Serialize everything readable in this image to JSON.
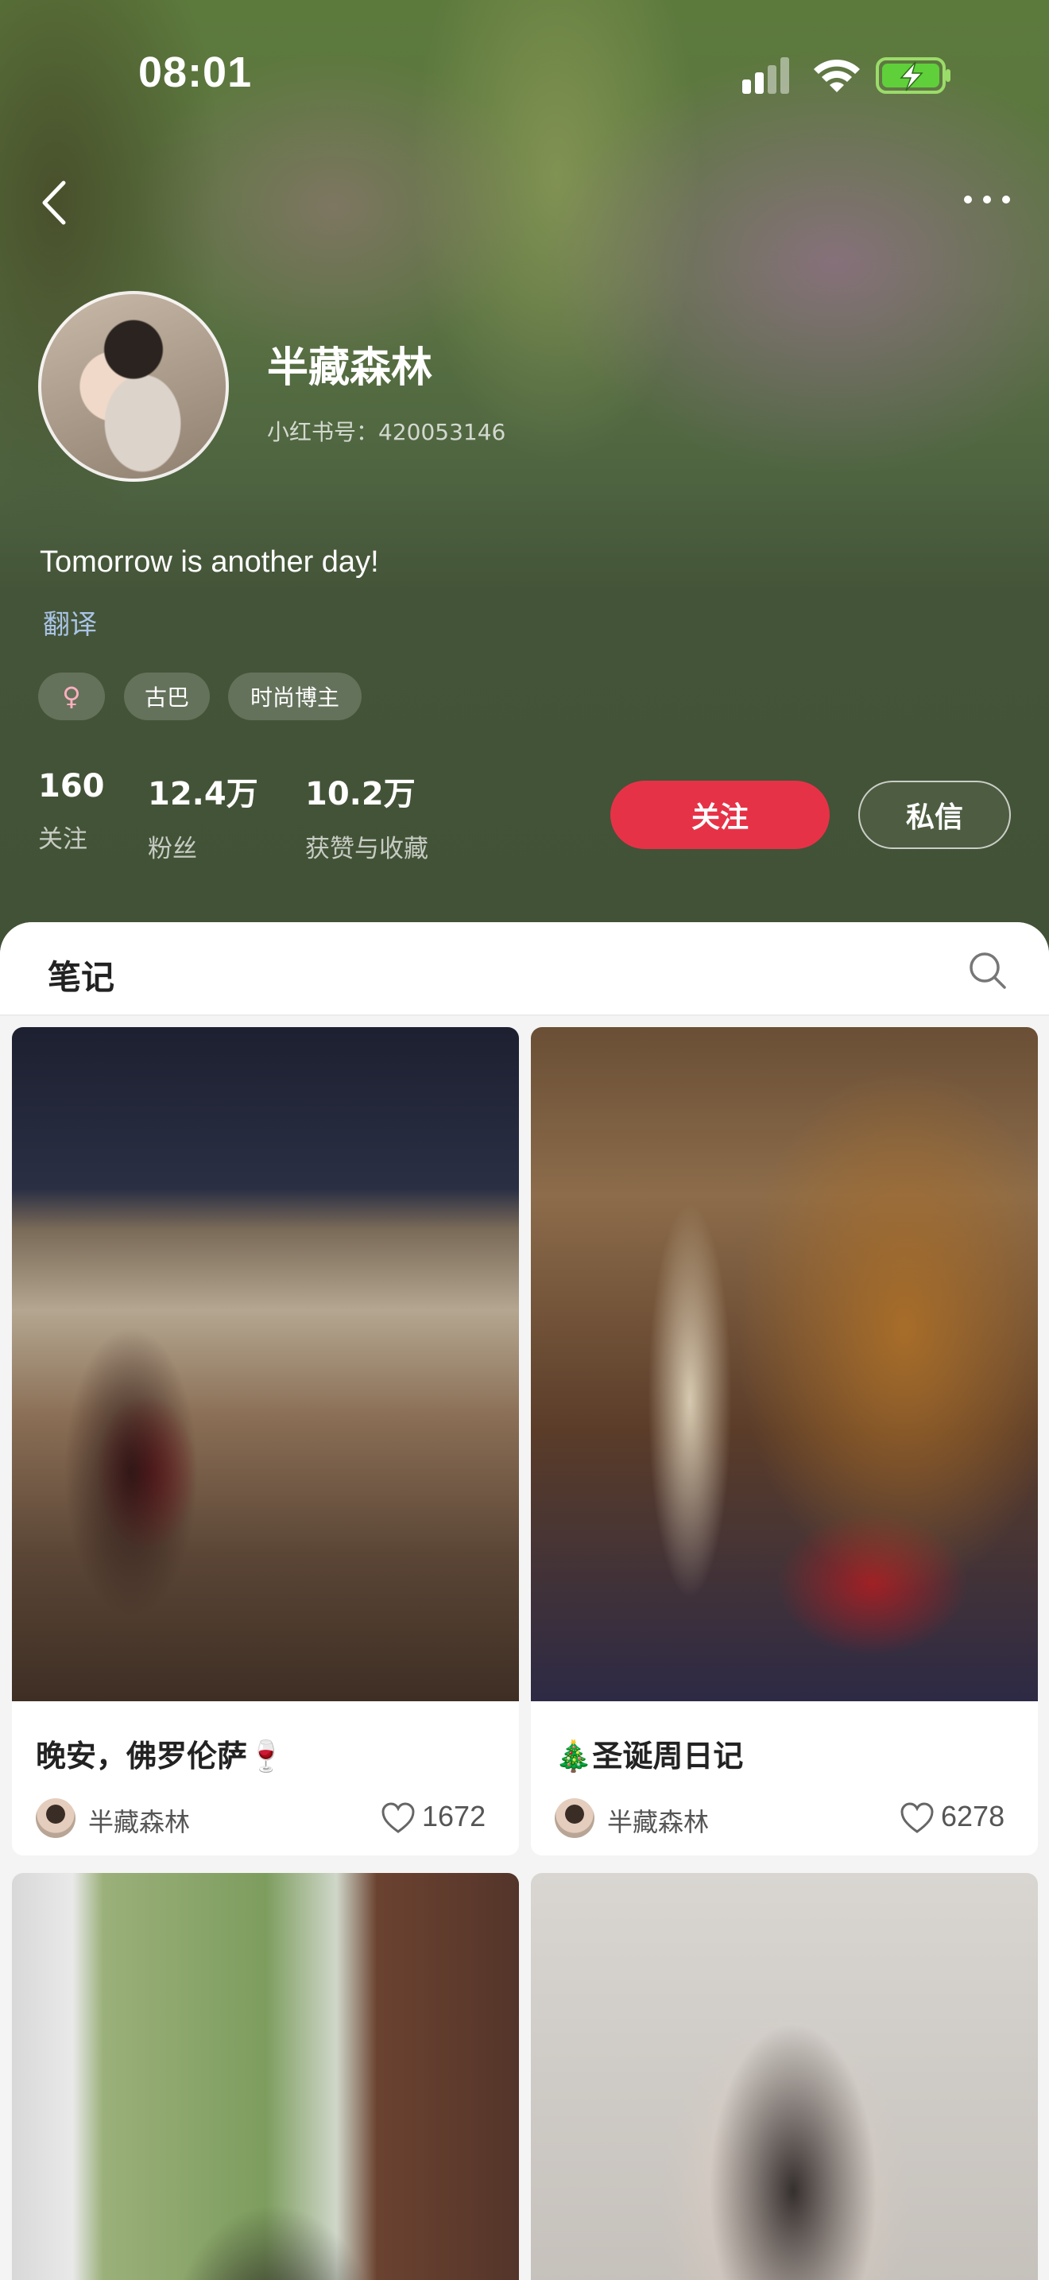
{
  "status_bar": {
    "time": "08:01"
  },
  "profile": {
    "name": "半藏森林",
    "id_text": "小红书号：420053146",
    "bio": "Tomorrow is another day!",
    "translate_label": "翻译",
    "gender_symbol": "♀",
    "tags": [
      "古巴",
      "时尚博主"
    ],
    "stats": [
      {
        "value": "160",
        "label": "关注"
      },
      {
        "value": "12.4万",
        "label": "粉丝"
      },
      {
        "value": "10.2万",
        "label": "获赞与收藏"
      }
    ],
    "follow_label": "关注",
    "message_label": "私信"
  },
  "tabs": {
    "notes_label": "笔记"
  },
  "notes": [
    {
      "title": "晚安，佛罗伦萨🍷",
      "author": "半藏森林",
      "likes": "1672"
    },
    {
      "title": "🎄圣诞周日记",
      "author": "半藏森林",
      "likes": "6278"
    }
  ],
  "colors": {
    "accent_red": "#e63247",
    "header_green": "#425236"
  },
  "icons": [
    "back-icon",
    "more-icon",
    "signal-icon",
    "wifi-icon",
    "battery-charging-icon",
    "search-icon",
    "heart-icon"
  ]
}
